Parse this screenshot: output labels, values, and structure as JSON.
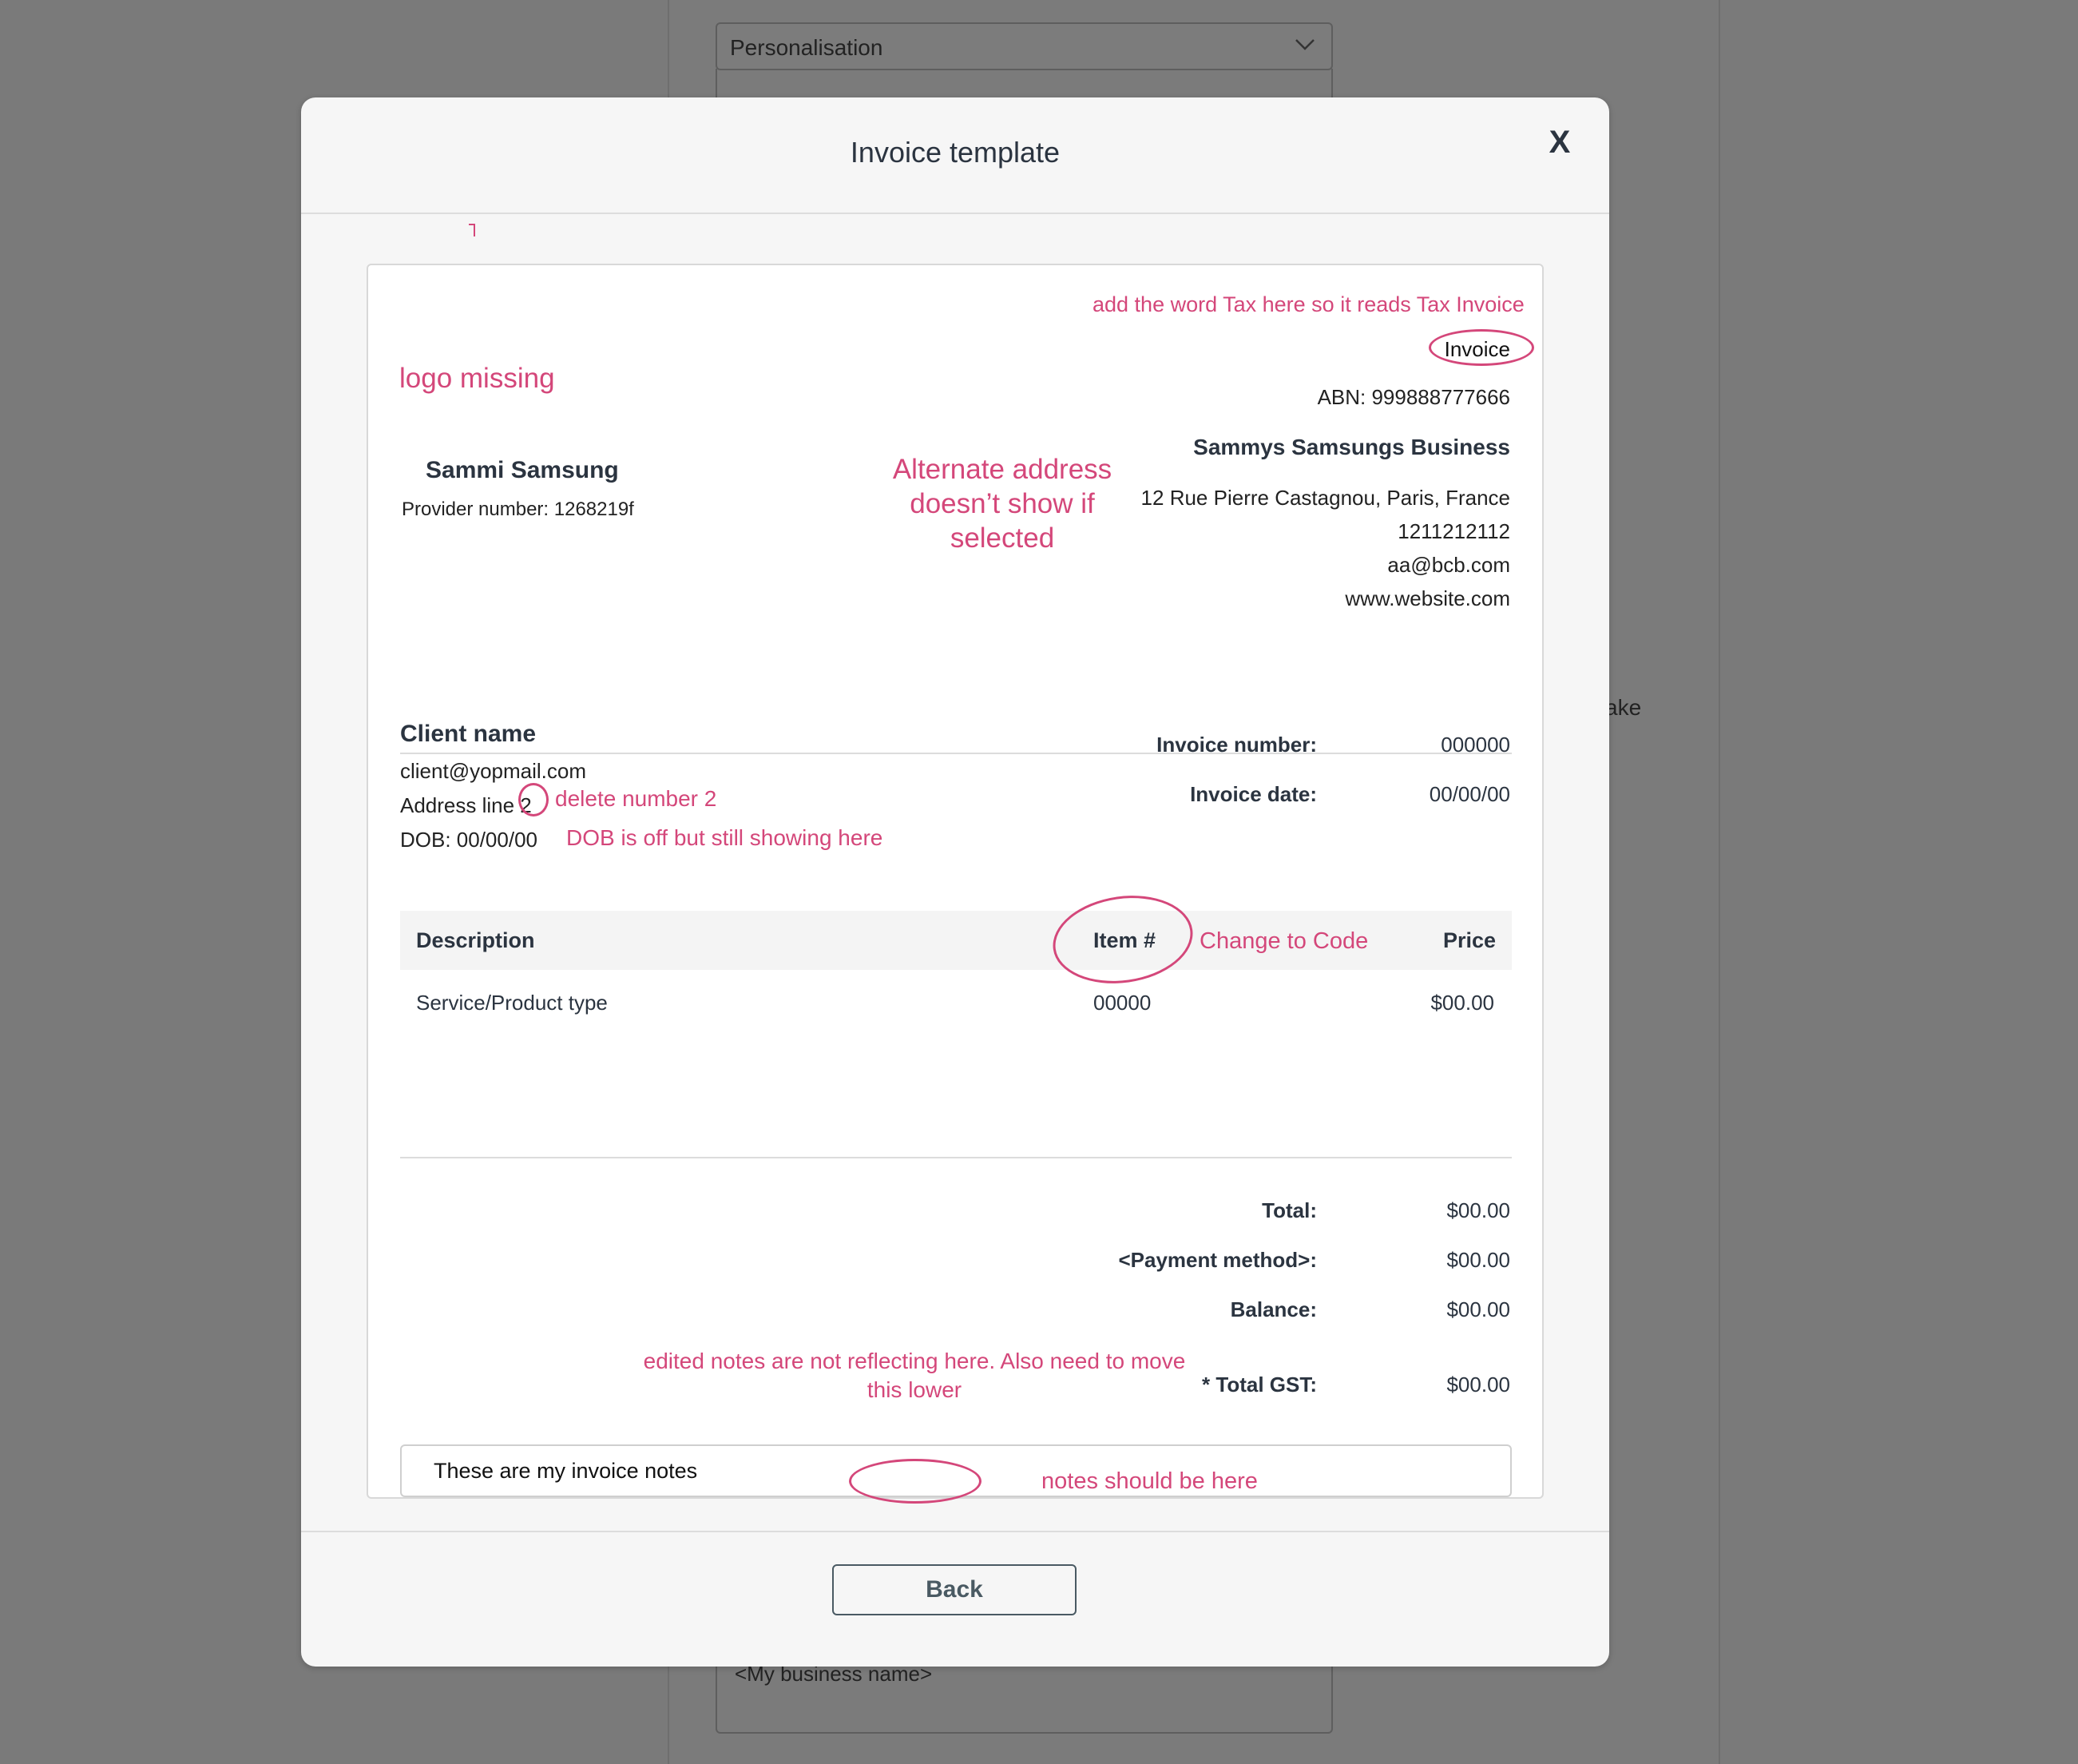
{
  "background": {
    "select_value": "Personalisation",
    "side_text": "ake",
    "textarea_value": "<My business name>"
  },
  "modal": {
    "title": "Invoice template",
    "close_label": "X",
    "back_label": "Back"
  },
  "invoice": {
    "doc_title": "Invoice",
    "abn": "ABN: 999888777666",
    "business": {
      "name": "Sammys Samsungs Business",
      "address": "12 Rue Pierre Castagnou, Paris, France",
      "phone": "1211212112",
      "email": "aa@bcb.com",
      "website": "www.website.com"
    },
    "provider": {
      "name": "Sammi Samsung",
      "number": "Provider number: 1268219f"
    },
    "client": {
      "name": "Client name",
      "email": "client@yopmail.com",
      "address": "Address line 2",
      "dob": "DOB: 00/00/00"
    },
    "meta": {
      "number_label": "Invoice number:",
      "number_value": "000000",
      "date_label": "Invoice date:",
      "date_value": "00/00/00"
    },
    "table": {
      "headers": {
        "description": "Description",
        "item": "Item #",
        "price": "Price"
      },
      "rows": [
        {
          "description": "Service/Product type",
          "item": "00000",
          "price": "$00.00"
        }
      ]
    },
    "summary": [
      {
        "label": "Total:",
        "value": "$00.00"
      },
      {
        "label": "<Payment method>:",
        "value": "$00.00"
      },
      {
        "label": "Balance:",
        "value": "$00.00"
      },
      {
        "label": "* Total GST:",
        "value": "$00.00"
      }
    ],
    "notes": "These are my invoice notes"
  },
  "annotations": {
    "tax": "add the word Tax here so it reads Tax Invoice",
    "logo": "logo missing",
    "alt_address_1": "Alternate address",
    "alt_address_2": "doesn’t show if",
    "alt_address_3": "selected",
    "delete_number": "delete number 2",
    "dob": "DOB is off but still showing here",
    "change_code": "Change to Code",
    "notes_1": "edited notes are not reflecting here. Also need to move",
    "notes_2": "this lower",
    "notes_here": "notes should be here",
    "color": "#d4477a"
  }
}
